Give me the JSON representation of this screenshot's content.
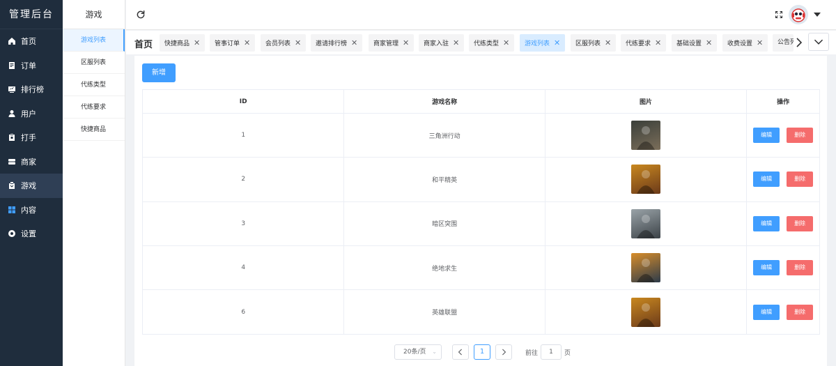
{
  "app": {
    "title": "管理后台"
  },
  "sidebar": {
    "items": [
      {
        "label": "首页",
        "icon": "home-icon"
      },
      {
        "label": "订单",
        "icon": "order-icon"
      },
      {
        "label": "排行榜",
        "icon": "ranking-icon"
      },
      {
        "label": "用户",
        "icon": "user-icon"
      },
      {
        "label": "打手",
        "icon": "player-icon"
      },
      {
        "label": "商家",
        "icon": "merchant-icon"
      },
      {
        "label": "游戏",
        "icon": "game-icon",
        "active": true
      },
      {
        "label": "内容",
        "icon": "content-icon"
      },
      {
        "label": "设置",
        "icon": "settings-icon"
      }
    ]
  },
  "submenu": {
    "title": "游戏",
    "items": [
      {
        "label": "游戏列表",
        "active": true
      },
      {
        "label": "区服列表"
      },
      {
        "label": "代练类型"
      },
      {
        "label": "代练要求"
      },
      {
        "label": "快捷商品"
      }
    ]
  },
  "tabs": {
    "home": "首页",
    "items": [
      {
        "label": "快捷商品"
      },
      {
        "label": "管事订单"
      },
      {
        "label": "会员列表"
      },
      {
        "label": "邀请排行榜"
      },
      {
        "label": "商家管理"
      },
      {
        "label": "商家入驻"
      },
      {
        "label": "代练类型"
      },
      {
        "label": "游戏列表",
        "active": true
      },
      {
        "label": "区服列表"
      },
      {
        "label": "代练要求"
      },
      {
        "label": "基础设置"
      },
      {
        "label": "收费设置"
      },
      {
        "label": "公告列"
      }
    ]
  },
  "toolbar": {
    "add_label": "新增"
  },
  "table": {
    "headers": [
      "ID",
      "游戏名称",
      "图片",
      "操作"
    ],
    "edit_label": "编辑",
    "delete_label": "删除",
    "rows": [
      {
        "id": "1",
        "name": "三角洲行动",
        "thumb_colors": [
          "#3a3f3a",
          "#7b6e5a"
        ]
      },
      {
        "id": "2",
        "name": "和平精英",
        "thumb_colors": [
          "#c9881f",
          "#6b3a1a"
        ]
      },
      {
        "id": "3",
        "name": "暗区突围",
        "thumb_colors": [
          "#9aa3a8",
          "#3c4348"
        ]
      },
      {
        "id": "4",
        "name": "绝地求生",
        "thumb_colors": [
          "#d88d2a",
          "#2d3b4a"
        ]
      },
      {
        "id": "6",
        "name": "英雄联盟",
        "thumb_colors": [
          "#c9881f",
          "#6b3a1a"
        ]
      }
    ]
  },
  "pagination": {
    "page_size": "20条/页",
    "current_page": "1",
    "goto_label": "前往",
    "goto_value": "1",
    "goto_suffix": "页"
  },
  "colors": {
    "sidebar_bg": "#1f2d3d",
    "primary": "#409eff",
    "danger": "#f56c6c"
  }
}
